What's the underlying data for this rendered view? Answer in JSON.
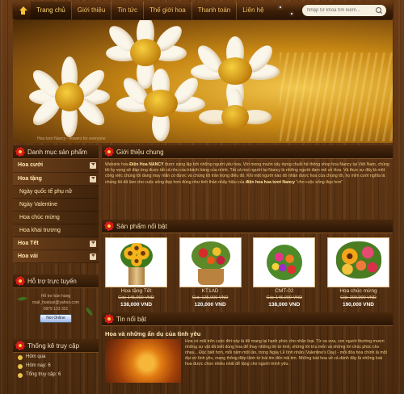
{
  "nav": {
    "items": [
      "Trang chủ",
      "Giới thiệu",
      "Tin tức",
      "Thế giới hoa",
      "Thanh toán",
      "Liên hệ"
    ],
    "search_placeholder": "Nhập từ khóa tìm kiếm..."
  },
  "banner": {
    "caption": "Hoa tươi Nancy - flowers for everyone"
  },
  "sidebar": {
    "categories_title": "Danh mục sản phẩm",
    "categories": [
      {
        "label": "Hoa cưới",
        "sub": false
      },
      {
        "label": "Hoa tặng",
        "sub": false
      },
      {
        "label": "Ngày quốc tế phụ nữ",
        "sub": true
      },
      {
        "label": "Ngày Valentine",
        "sub": true
      },
      {
        "label": "Hoa chúc mừng",
        "sub": true
      },
      {
        "label": "Hoa khai trương",
        "sub": true
      },
      {
        "label": "Hoa Tết",
        "sub": false
      },
      {
        "label": "Hoa vải",
        "sub": false
      }
    ],
    "support_title": "Hỗ trợ trực tuyến",
    "support_lines": [
      "Hỗ trợ bán hàng",
      "mail_hoatuoi@yahoo.com",
      "0979 123 321"
    ],
    "online_label": "Not Online",
    "stats_title": "Thống kê truy cập",
    "stats": [
      {
        "label": "Hôm qua"
      },
      {
        "label": "Hôm nay: 6"
      },
      {
        "label": "Tổng truy cập: 6"
      }
    ]
  },
  "intro": {
    "title": "Giới thiệu chung",
    "p1_a": "Website hoa ",
    "p1_b": "Điện Hoa NANCY",
    "p1_c": " được sáng lập bởi những người yêu hoa. Với mong muốn xây dựng chuỗi hệ thống shop hoa Nancy tại Việt Nam, chúng tôi hy vọng sẽ đáp ứng được tất cả nhu cầu khách hàng của mình. Tất cả mọi người tại Nancy là những người đam mê về Hoa. Và thực sự đây là một công việc chúng tôi đang may mắn có được và chúng tôi trân trọng điều đó. Khi một người nào đó nhận được hoa của chúng tôi, họ mỉm cười nghĩa là chúng tôi đã làm cho cuộc sống đẹp hơn đúng như tinh thần nhãy hiệu của ",
    "p1_d": "điện hoa hoa tươi Nancy",
    "p1_e": " \"cho cuộc sống đẹp hơn\""
  },
  "products": {
    "title": "Sản phẩm nổi bật",
    "items": [
      {
        "name": "Hoa tặng Tết",
        "old": "Giá: 145,000 VND",
        "price": "138,000 VND"
      },
      {
        "name": "KT1AD",
        "old": "Giá: 125,000 VND",
        "price": "120,000 VND"
      },
      {
        "name": "CMT-02",
        "old": "Giá: 145,000 VND",
        "price": "138,000 VND"
      },
      {
        "name": "Hoa chúc mừng",
        "old": "Giá: 200,000 VND",
        "price": "190,000 VND"
      }
    ]
  },
  "news": {
    "title": "Tin nổi bật",
    "headline": "Hoa và những ẩn dụ của tình yêu",
    "body": "Hoa có mãi trên cuộc đời này là để mang lại hạnh phúc cho nhân loại. Từ xa xưa, con người thường mượn những sự vật đã biết dùng hoa để thay những lời từ tình, những lời trìu mến và những lời chúc phúc cho nhau... Đặc biệt hơn, mỗi năm một lần, trong Ngày Lễ tình nhân (Valentine's Day) - mỗi đóa hoa chính là một đại sứ tình yêu, mang thông điệp lãnh từ trái tim đến trái tim. Những loài hoa về cả dành đây là những loài hoa được chọn nhiều nhất để tặng cho người mình yêu."
  }
}
